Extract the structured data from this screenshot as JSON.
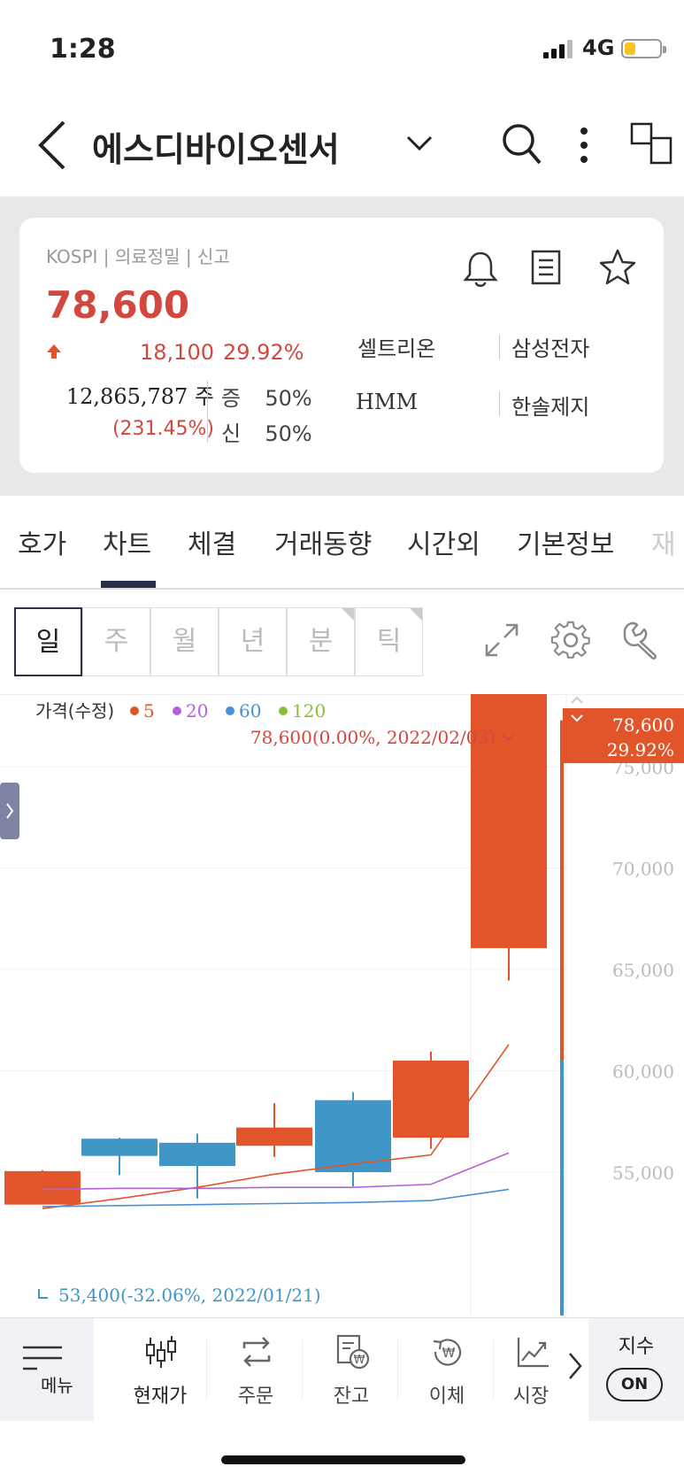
{
  "status_bar": {
    "time": "1:28",
    "network": "4G"
  },
  "header": {
    "title": "에스디바이오센서"
  },
  "stock": {
    "market_info": "KOSPI | 의료정밀 | 신고",
    "price": "78,600",
    "change": "18,100",
    "change_rate": "29.92%",
    "volume": "12,865,787 주",
    "volume_rate": "(231.45%)",
    "margin_deposit_label": "증",
    "margin_deposit_value": "50%",
    "credit_label": "신",
    "credit_value": "50%",
    "related": [
      "셀트리온",
      "삼성전자",
      "HMM",
      "한솔제지"
    ]
  },
  "tabs": [
    "호가",
    "차트",
    "체결",
    "거래동향",
    "시간외",
    "기본정보",
    "재"
  ],
  "active_tab": "차트",
  "periods": [
    "일",
    "주",
    "월",
    "년",
    "분",
    "틱"
  ],
  "active_period": "일",
  "chart_data": {
    "type": "candlestick",
    "legend_title": "가격(수정)",
    "moving_averages": [
      {
        "name": "5",
        "color": "#e2552a"
      },
      {
        "name": "20",
        "color": "#b463d6"
      },
      {
        "name": "60",
        "color": "#4a90d9"
      },
      {
        "name": "120",
        "color": "#8bbd3b"
      }
    ],
    "y_ticks": [
      "75,000",
      "70,000",
      "65,000",
      "60,000",
      "55,000"
    ],
    "ylim": [
      52000,
      80500
    ],
    "candles": [
      {
        "open": 55050,
        "close": 53400,
        "high": 55100,
        "low": 53400,
        "color": "up"
      },
      {
        "open": 56650,
        "close": 55800,
        "high": 56700,
        "low": 54850,
        "color": "down"
      },
      {
        "open": 56450,
        "close": 55300,
        "high": 56900,
        "low": 53700,
        "color": "down"
      },
      {
        "open": 56300,
        "close": 57200,
        "high": 58400,
        "low": 55750,
        "color": "up"
      },
      {
        "open": 58550,
        "close": 55000,
        "high": 58950,
        "low": 54300,
        "color": "down"
      },
      {
        "open": 56700,
        "close": 60500,
        "high": 60950,
        "low": 56150,
        "color": "up"
      },
      {
        "open": 66050,
        "close": 78600,
        "high": 78600,
        "low": 64450,
        "color": "up"
      }
    ],
    "ma5": [
      53200,
      53700,
      54250,
      54900,
      55400,
      55850,
      61300
    ],
    "ma20": [
      54150,
      54200,
      54200,
      54250,
      54250,
      54400,
      55950
    ],
    "ma60": [
      53300,
      53350,
      53400,
      53450,
      53500,
      53600,
      54150
    ],
    "current_price_label": "78,600",
    "current_rate_label": "29.92%",
    "high_annotation": "78,600(0.00%, 2022/02/03)",
    "low_annotation": "53,400(-32.06%, 2022/01/21)",
    "volume_bar_value": 60500
  },
  "bottom_nav": {
    "menu": "메뉴",
    "items": [
      "현재가",
      "주문",
      "잔고",
      "이체",
      "시장"
    ],
    "index_label": "지수",
    "index_toggle": "ON"
  }
}
